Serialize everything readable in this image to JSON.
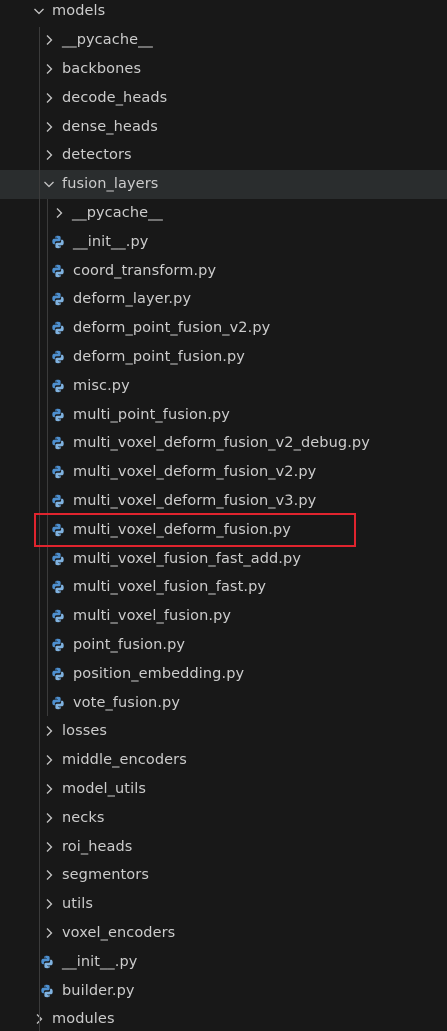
{
  "explorer": {
    "items": [
      {
        "label": "models",
        "type": "folder",
        "state": "expanded",
        "depth": 0
      },
      {
        "label": "__pycache__",
        "type": "folder",
        "state": "collapsed",
        "depth": 1
      },
      {
        "label": "backbones",
        "type": "folder",
        "state": "collapsed",
        "depth": 1
      },
      {
        "label": "decode_heads",
        "type": "folder",
        "state": "collapsed",
        "depth": 1
      },
      {
        "label": "dense_heads",
        "type": "folder",
        "state": "collapsed",
        "depth": 1
      },
      {
        "label": "detectors",
        "type": "folder",
        "state": "collapsed",
        "depth": 1
      },
      {
        "label": "fusion_layers",
        "type": "folder",
        "state": "expanded",
        "depth": 1
      },
      {
        "label": "__pycache__",
        "type": "folder",
        "state": "collapsed",
        "depth": 2
      },
      {
        "label": "__init__.py",
        "type": "python-file",
        "depth": 2
      },
      {
        "label": "coord_transform.py",
        "type": "python-file",
        "depth": 2
      },
      {
        "label": "deform_layer.py",
        "type": "python-file",
        "depth": 2
      },
      {
        "label": "deform_point_fusion_v2.py",
        "type": "python-file",
        "depth": 2
      },
      {
        "label": "deform_point_fusion.py",
        "type": "python-file",
        "depth": 2
      },
      {
        "label": "misc.py",
        "type": "python-file",
        "depth": 2
      },
      {
        "label": "multi_point_fusion.py",
        "type": "python-file",
        "depth": 2
      },
      {
        "label": "multi_voxel_deform_fusion_v2_debug.py",
        "type": "python-file",
        "depth": 2
      },
      {
        "label": "multi_voxel_deform_fusion_v2.py",
        "type": "python-file",
        "depth": 2
      },
      {
        "label": "multi_voxel_deform_fusion_v3.py",
        "type": "python-file",
        "depth": 2
      },
      {
        "label": "multi_voxel_deform_fusion.py",
        "type": "python-file",
        "depth": 2,
        "highlighted": true
      },
      {
        "label": "multi_voxel_fusion_fast_add.py",
        "type": "python-file",
        "depth": 2
      },
      {
        "label": "multi_voxel_fusion_fast.py",
        "type": "python-file",
        "depth": 2
      },
      {
        "label": "multi_voxel_fusion.py",
        "type": "python-file",
        "depth": 2
      },
      {
        "label": "point_fusion.py",
        "type": "python-file",
        "depth": 2
      },
      {
        "label": "position_embedding.py",
        "type": "python-file",
        "depth": 2
      },
      {
        "label": "vote_fusion.py",
        "type": "python-file",
        "depth": 2
      },
      {
        "label": "losses",
        "type": "folder",
        "state": "collapsed",
        "depth": 1
      },
      {
        "label": "middle_encoders",
        "type": "folder",
        "state": "collapsed",
        "depth": 1
      },
      {
        "label": "model_utils",
        "type": "folder",
        "state": "collapsed",
        "depth": 1
      },
      {
        "label": "necks",
        "type": "folder",
        "state": "collapsed",
        "depth": 1
      },
      {
        "label": "roi_heads",
        "type": "folder",
        "state": "collapsed",
        "depth": 1
      },
      {
        "label": "segmentors",
        "type": "folder",
        "state": "collapsed",
        "depth": 1
      },
      {
        "label": "utils",
        "type": "folder",
        "state": "collapsed",
        "depth": 1
      },
      {
        "label": "voxel_encoders",
        "type": "folder",
        "state": "collapsed",
        "depth": 1
      },
      {
        "label": "__init__.py",
        "type": "python-file",
        "depth": 1
      },
      {
        "label": "builder.py",
        "type": "python-file",
        "depth": 1
      },
      {
        "label": "modules",
        "type": "folder",
        "state": "collapsed",
        "depth": 0
      }
    ]
  },
  "colors": {
    "background": "#181818",
    "text": "#cccccc",
    "hover_row": "#2a2d2e",
    "python_icon": "#4d8fcf",
    "highlight_box": "#e0242e"
  }
}
